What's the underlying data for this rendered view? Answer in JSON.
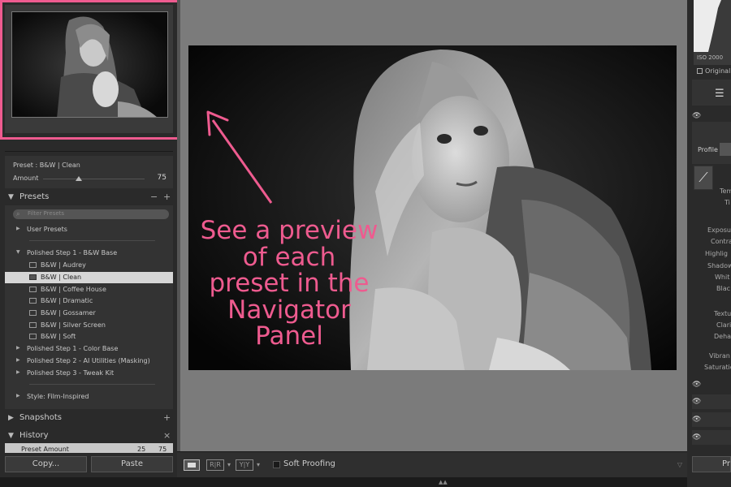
{
  "navigator": {
    "panel": "Navigator"
  },
  "preset_info": {
    "preset_name": "Preset : B&W | Clean",
    "amount_label": "Amount",
    "amount_value": "75",
    "amount_fraction": 0.35
  },
  "presets": {
    "title": "Presets",
    "minus": "−",
    "plus": "+",
    "filter_placeholder": "Filter Presets",
    "groups": [
      {
        "label": "User Presets",
        "expanded": false
      },
      {
        "label": "Polished Step 1 - B&W Base",
        "expanded": true
      },
      {
        "label": "Polished Step 1 - Color Base",
        "expanded": false
      },
      {
        "label": "Polished Step 2 - AI Utilities (Masking)",
        "expanded": false
      },
      {
        "label": "Polished Step 3 - Tweak Kit",
        "expanded": false
      },
      {
        "label": "Style: Film-Inspired",
        "expanded": false
      }
    ],
    "items": [
      {
        "label": "B&W | Audrey",
        "selected": false
      },
      {
        "label": "B&W | Clean",
        "selected": true
      },
      {
        "label": "B&W | Coffee House",
        "selected": false
      },
      {
        "label": "B&W | Dramatic",
        "selected": false
      },
      {
        "label": "B&W | Gossamer",
        "selected": false
      },
      {
        "label": "B&W | Silver Screen",
        "selected": false
      },
      {
        "label": "B&W | Soft",
        "selected": false
      }
    ]
  },
  "snapshots": {
    "title": "Snapshots",
    "plus": "+"
  },
  "history": {
    "title": "History",
    "close": "×",
    "row": "Preset Amount",
    "v1": "25",
    "v2": "75"
  },
  "buttons": {
    "copy": "Copy...",
    "paste": "Paste"
  },
  "annotation": {
    "lines": [
      "See a preview",
      "of each",
      "preset in the",
      "Navigator",
      "Panel"
    ],
    "color": "#ee5b8f"
  },
  "toolbar": {
    "rr": "R|R",
    "yy": "Y|Y",
    "soft_proofing": "Soft Proofing"
  },
  "right": {
    "iso": "ISO 2000",
    "original": "Original",
    "profile": "Profile :",
    "labels": [
      "Tem",
      "Ti",
      "Exposu",
      "Contra",
      "Highlig",
      "Shadow",
      "Whit",
      "Blac",
      "Textu",
      "Clari",
      "Deha",
      "Vibran",
      "Saturatio"
    ],
    "pr": "Pr"
  }
}
